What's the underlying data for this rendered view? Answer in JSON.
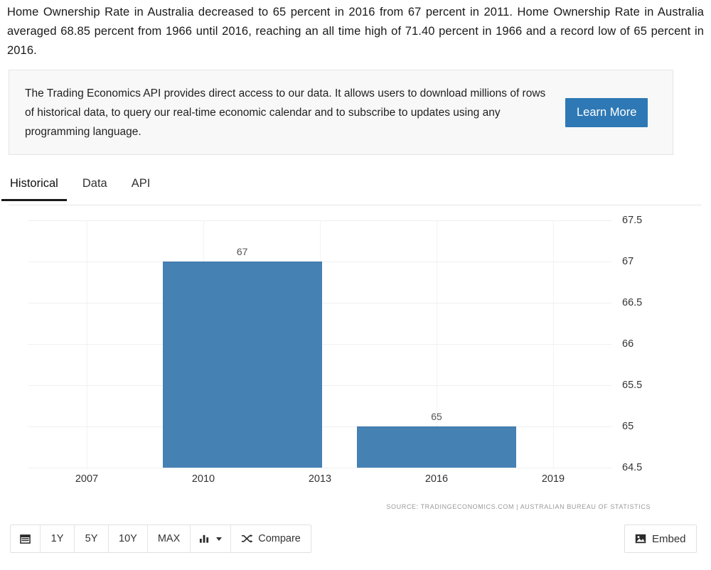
{
  "intro": {
    "text": "Home Ownership Rate in Australia decreased to 65 percent in 2016 from 67 percent in 2011. Home Ownership Rate in Australia averaged 68.85 percent from 1966 until 2016, reaching an all time high of 71.40 percent in 1966 and a record low of 65 percent in 2016."
  },
  "api_banner": {
    "text": "The Trading Economics API provides direct access to our data. It allows users to download millions of rows of historical data, to query our real-time economic calendar and to subscribe to updates using any programming language.",
    "button_label": "Learn More",
    "button_color": "#2e79b5",
    "background_color": "#f8f8f8"
  },
  "tabs": [
    {
      "label": "Historical",
      "active": true
    },
    {
      "label": "Data",
      "active": false
    },
    {
      "label": "API",
      "active": false
    }
  ],
  "chart_data": {
    "type": "bar",
    "title": "",
    "subtitle": "",
    "xlabel": "",
    "ylabel": "",
    "categories": [
      "2011",
      "2016"
    ],
    "values": [
      67,
      65
    ],
    "data_labels": [
      "67",
      "65"
    ],
    "series": [
      {
        "name": "Home Ownership Rate",
        "values": [
          67,
          65
        ]
      }
    ],
    "x_tick_labels": [
      "2007",
      "2010",
      "2013",
      "2016",
      "2019"
    ],
    "x_tick_values": [
      2007,
      2010,
      2013,
      2016,
      2019
    ],
    "y_tick_labels": [
      "67.5",
      "67",
      "66.5",
      "66",
      "65.5",
      "65",
      "64.5"
    ],
    "y_tick_values": [
      67.5,
      67,
      66.5,
      66,
      65.5,
      65,
      64.5
    ],
    "ylim": [
      64.5,
      67.5
    ],
    "xlim": [
      2005.5,
      2020.5
    ],
    "grid": true,
    "legend": false,
    "bar_color": "#4681b4",
    "source": "SOURCE: TRADINGECONOMICS.COM | AUSTRALIAN BUREAU OF STATISTICS"
  },
  "toolbar": {
    "calendar_label": "",
    "ranges": [
      "1Y",
      "5Y",
      "10Y",
      "MAX"
    ],
    "chart_type_label": "",
    "compare_label": "Compare",
    "embed_label": "Embed"
  }
}
